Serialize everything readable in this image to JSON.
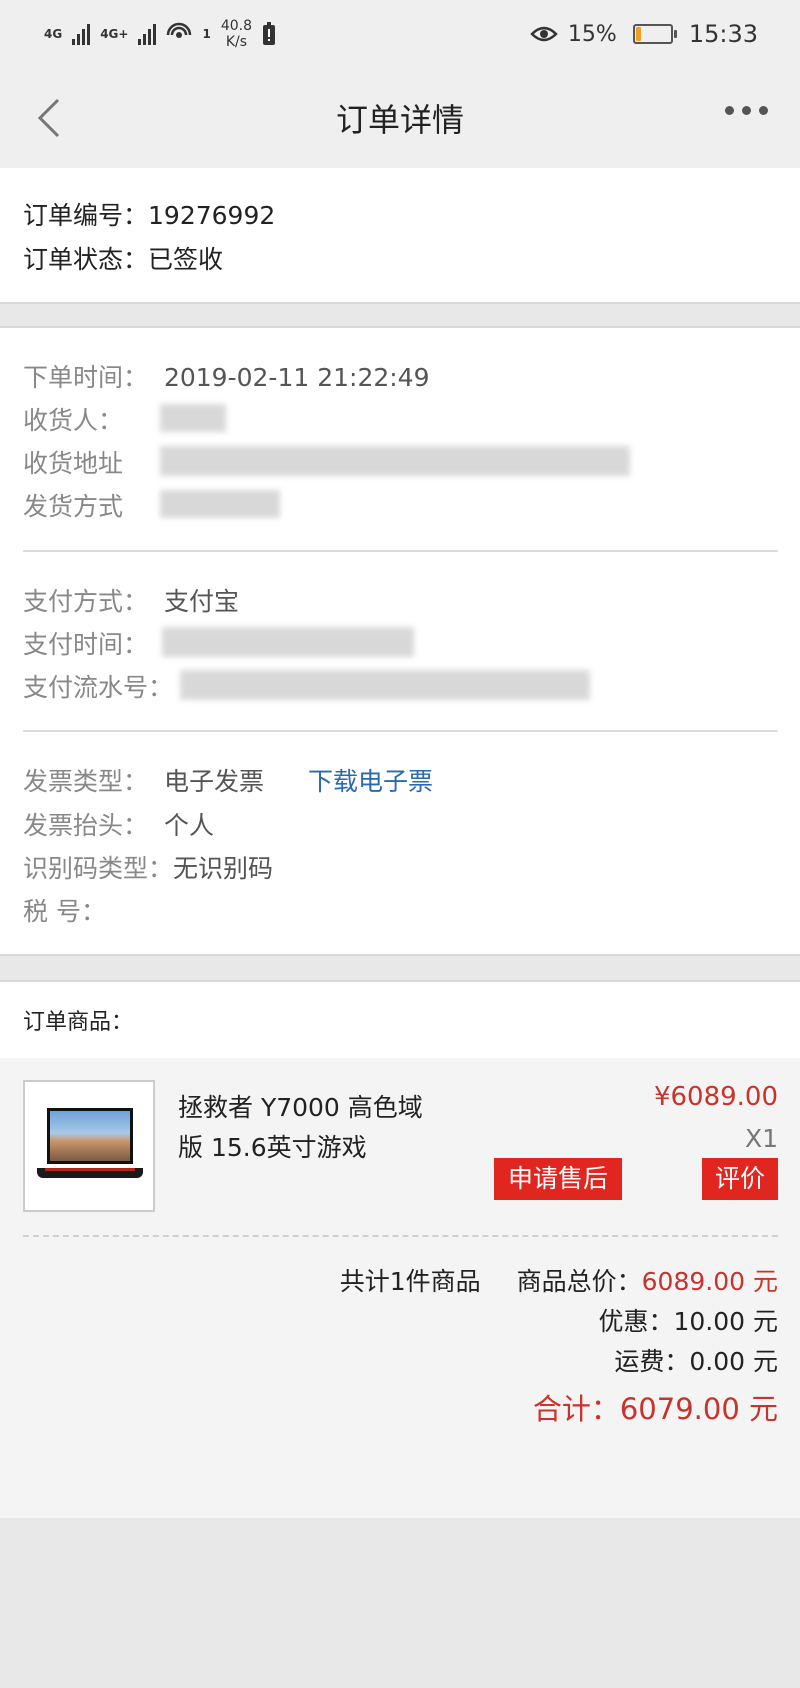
{
  "status_bar": {
    "net1": "4G",
    "net2": "4G+",
    "wifi_count": "1",
    "speed_value": "40.8",
    "speed_unit": "K/s",
    "battery_percent": "15%",
    "battery_level": 0.15,
    "time": "15:33"
  },
  "header": {
    "title": "订单详情"
  },
  "order": {
    "number_label": "订单编号：",
    "number_value": "19276992",
    "status_label": "订单状态：",
    "status_value": "已签收"
  },
  "shipping": {
    "order_time_label": "下单时间：",
    "order_time_value": "2019-02-11 21:22:49",
    "receiver_label": "收货人：",
    "address_label": "收货地址",
    "ship_method_label": "发货方式"
  },
  "payment": {
    "method_label": "支付方式：",
    "method_value": "支付宝",
    "time_label": "支付时间：",
    "serial_label": "支付流水号："
  },
  "invoice": {
    "type_label": "发票类型：",
    "type_value": "电子发票",
    "download_link": "下载电子票",
    "header_label": "发票抬头：",
    "header_value": "个人",
    "idcode_label": "识别码类型：",
    "idcode_value": "无识别码",
    "tax_label": "税 号："
  },
  "products": {
    "section_label": "订单商品：",
    "items": [
      {
        "name": "拯救者 Y7000 高色域版 15.6英寸游戏",
        "price": "¥6089.00",
        "qty": "X1",
        "after_sale_button": "申请售后",
        "review_button": "评价"
      }
    ],
    "count_text": "共计1件商品",
    "goods_total_label": "商品总价：",
    "goods_total_value": "6089.00 元",
    "discount_label": "优惠：",
    "discount_value": "10.00 元",
    "freight_label": "运费：",
    "freight_value": "0.00 元",
    "grand_total_label": "合计：",
    "grand_total_value": "6079.00 元"
  },
  "colors": {
    "accent_red": "#c8332b",
    "button_red": "#e0261f",
    "link_blue": "#2a6bb0"
  }
}
